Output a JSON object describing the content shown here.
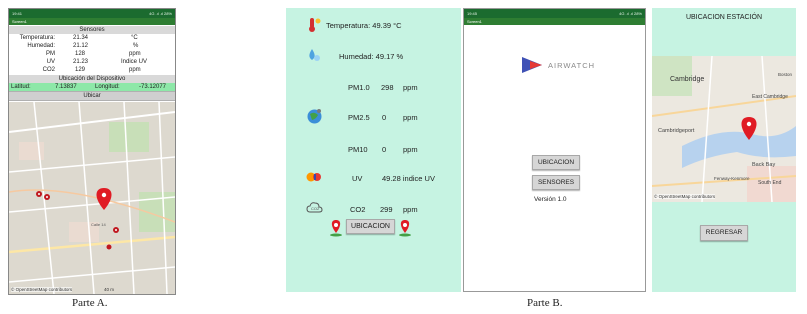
{
  "part_a": {
    "status_bar": {
      "time": "19:41",
      "right": "4G .ıl .ıl 28%"
    },
    "app_bar_title": "Screen1",
    "sensors_header": "Sensores",
    "sensors": [
      {
        "name": "Temperatura:",
        "value": "21.34",
        "unit": "°C"
      },
      {
        "name": "Humedad:",
        "value": "21.12",
        "unit": "%"
      },
      {
        "name": "PM",
        "value": "128",
        "unit": "ppm"
      },
      {
        "name": "UV",
        "value": "21.23",
        "unit": "Indice UV"
      },
      {
        "name": "CO2",
        "value": "129",
        "unit": "ppm"
      }
    ],
    "location_header": "Ubicación del Dispositivo",
    "lat_label": "Latitud:",
    "lat_value": "7.13837",
    "lon_label": "Longitud:",
    "lon_value": "-73.12077",
    "locate_button": "Ubicar",
    "map_attribution": "© OpenStreetMap contributors",
    "map_scale": "40 m",
    "map_street": "Calle 14"
  },
  "part_b": {
    "screen1": {
      "temperature": "Temperatura: 49.39 °C",
      "humidity": "Humedad:  49.17 %",
      "pm10_label": "PM1.0",
      "pm10_value": "298",
      "pm10_unit": "ppm",
      "pm25_label": "PM2.5",
      "pm25_value": "0",
      "pm25_unit": "ppm",
      "pm100_label": "PM10",
      "pm100_value": "0",
      "pm100_unit": "ppm",
      "uv_label": "UV",
      "uv_value": "49.28 indice UV",
      "co2_label": "CO2",
      "co2_value": "299",
      "co2_unit": "ppm",
      "location_button": "UBICACION"
    },
    "screen2": {
      "status_time": "19:45",
      "status_right": "4G .ıl .ıl 28%",
      "app_bar_title": "Screen1",
      "brand": "AIRWATCH",
      "location_button": "UBICACION",
      "sensors_button": "SENSORES",
      "version": "Versión 1.0"
    },
    "screen3": {
      "title": "UBICACION ESTACIÓN",
      "map_labels": [
        "Cambridge",
        "East Cambridge",
        "Cambridgeport",
        "Back Bay",
        "South End",
        "Fenway-Kenmore",
        "Boston"
      ],
      "map_attribution": "© OpenStreetMap contributors",
      "back_button": "REGRESAR"
    }
  },
  "captions": {
    "part_a": "Parte A.",
    "part_b": "Parte B."
  },
  "colors": {
    "status_green": "#1b6b2f",
    "mint": "#c6f3e2",
    "location_row": "#8de8a8",
    "pin_red": "#e01b24",
    "water": "#b7d2ee"
  }
}
